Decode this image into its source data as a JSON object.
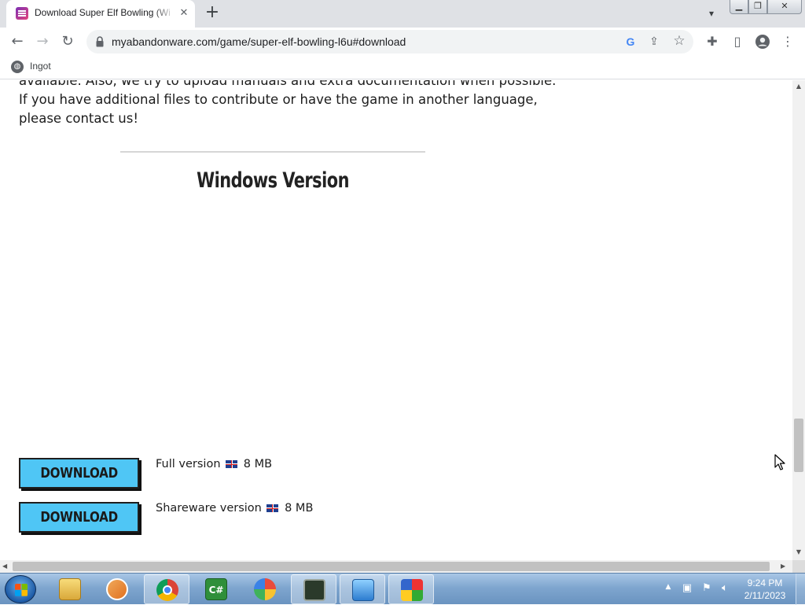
{
  "browser": {
    "tab_title": "Download Super Elf Bowling (Wi",
    "new_tab_icon": "+",
    "tab_close_icon": "✕",
    "url": "myabandonware.com/game/super-elf-bowling-l6u#download",
    "bookmark_label": "Ingot"
  },
  "page": {
    "intro_lines": [
      "available. Also, we try to upload manuals and extra documentation when possible.",
      "If you have additional files to contribute or have the game in another language,",
      "please contact us!"
    ],
    "section_heading": "Windows Version",
    "downloads": [
      {
        "button_label": "DOWNLOAD",
        "name": "Full version",
        "size": "8 MB",
        "language_flag": "uk-flag-icon"
      },
      {
        "button_label": "DOWNLOAD",
        "name": "Shareware version",
        "size": "8 MB",
        "language_flag": "uk-flag-icon"
      }
    ]
  },
  "taskbar": {
    "time": "9:24 PM",
    "date": "2/11/2023",
    "pinned": [
      "file-explorer-icon",
      "media-player-icon",
      "chrome-icon",
      "csharp-icon",
      "browser-shield-icon",
      "monitor-app-icon",
      "control-panel-icon",
      "avg-icon"
    ]
  },
  "colors": {
    "download_button": "#4fc6f5",
    "chrome_tabstrip": "#dfe1e5",
    "taskbar": "#7fa6cf"
  }
}
